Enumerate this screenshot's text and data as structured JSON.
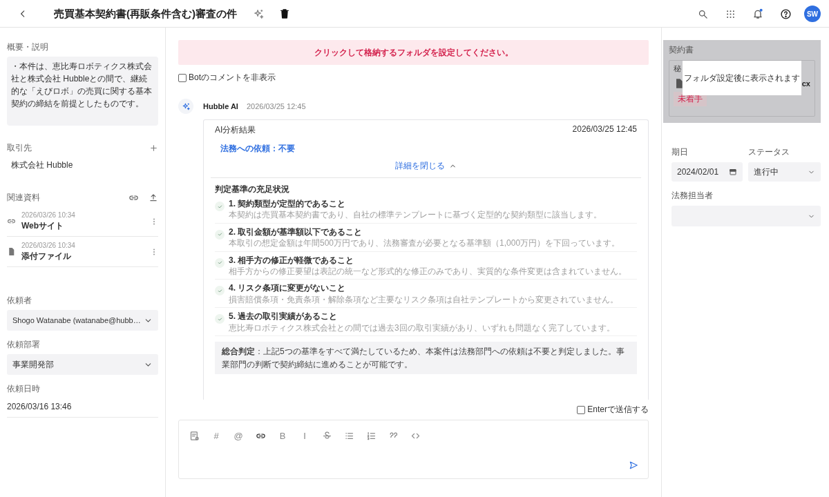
{
  "header": {
    "title": "売買基本契約書(再販条件含む)審査の件",
    "avatar_initials": "SW"
  },
  "summary": {
    "label": "概要・説明",
    "text": "・本件は、恵比寿ロボティクス株式会社と株式会社 Hubbleとの間で、継続的な「えびロボ」の売買に関する基本契約の締結を前提としたものです。"
  },
  "client": {
    "label": "取引先",
    "value": "株式会社 Hubble"
  },
  "related": {
    "label": "関連資料",
    "items": [
      {
        "kind": "link",
        "date": "2026/03/26 10:34",
        "name": "Webサイト"
      },
      {
        "kind": "file",
        "date": "2026/03/26 10:34",
        "name": "添付ファイル"
      }
    ]
  },
  "requester": {
    "label": "依頼者",
    "value": "Shogo Watanabe (watanabe@hubb…"
  },
  "department": {
    "label": "依頼部署",
    "value": "事業開発部"
  },
  "requested_at": {
    "label": "依頼日時",
    "value": "2026/03/16 13:46"
  },
  "banner": "クリックして格納するフォルダを設定してください。",
  "hide_bot": {
    "label": "Botのコメントを非表示",
    "checked": false
  },
  "message": {
    "author": "Hubble AI",
    "time": "2026/03/25 12:45",
    "card": {
      "title": "AI分析結果",
      "time": "2026/03/25 12:45",
      "verdict": "法務への依頼：不要",
      "toggle": "詳細を閉じる",
      "expanded": true,
      "criteria_title": "判定基準の充足状況",
      "criteria": [
        {
          "title": "1. 契約類型が定型的であること",
          "description": "本契約は売買基本契約書であり、自社の標準テンプレートに基づく定型的な契約類型に該当します。",
          "met": true
        },
        {
          "title": "2. 取引金額が基準額以下であること",
          "description": "本取引の想定金額は年間500万円であり、法務審査が必要となる基準額（1,000万円）を下回っています。",
          "met": true
        },
        {
          "title": "3. 相手方の修正が軽微であること",
          "description": "相手方からの修正要望は表記の統一など形式的な修正のみであり、実質的な条件変更は含まれていません。",
          "met": true
        },
        {
          "title": "4. リスク条項に変更がないこと",
          "description": "損害賠償条項・免責条項・解除条項など主要なリスク条項は自社テンプレートから変更されていません。",
          "met": true
        },
        {
          "title": "5. 過去の取引実績があること",
          "description": "恵比寿ロボティクス株式会社との間では過去3回の取引実績があり、いずれも問題なく完了しています。",
          "met": true
        }
      ],
      "summary": "**総合判定**：上記5つの基準をすべて満たしているため、本案件は法務部門への依頼は不要と判定しました。事業部門の判断で契約締結に進めることが可能です。"
    }
  },
  "enter_to_send": {
    "label": "Enterで送信する",
    "checked": false
  },
  "composer": {
    "toolbar": [
      {
        "kind": "icon"
      },
      {
        "kind": "glyph",
        "label": "#"
      },
      {
        "kind": "glyph",
        "label": "@"
      },
      {
        "kind": "icon"
      },
      {
        "kind": "glyph",
        "label": "B"
      },
      {
        "kind": "glyph",
        "label": "I"
      },
      {
        "kind": "icon"
      },
      {
        "kind": "icon"
      },
      {
        "kind": "icon"
      },
      {
        "kind": "icon"
      },
      {
        "kind": "icon"
      }
    ]
  },
  "contract": {
    "label": "契約書",
    "file_label": "秘",
    "file_name": "cx",
    "status": "未着手",
    "tooltip": "フォルダ設定後に表示されます"
  },
  "due": {
    "label": "期日",
    "value": "2024/02/01"
  },
  "status": {
    "label": "ステータス",
    "value": "進行中"
  },
  "legal_owner": {
    "label": "法務担当者"
  }
}
